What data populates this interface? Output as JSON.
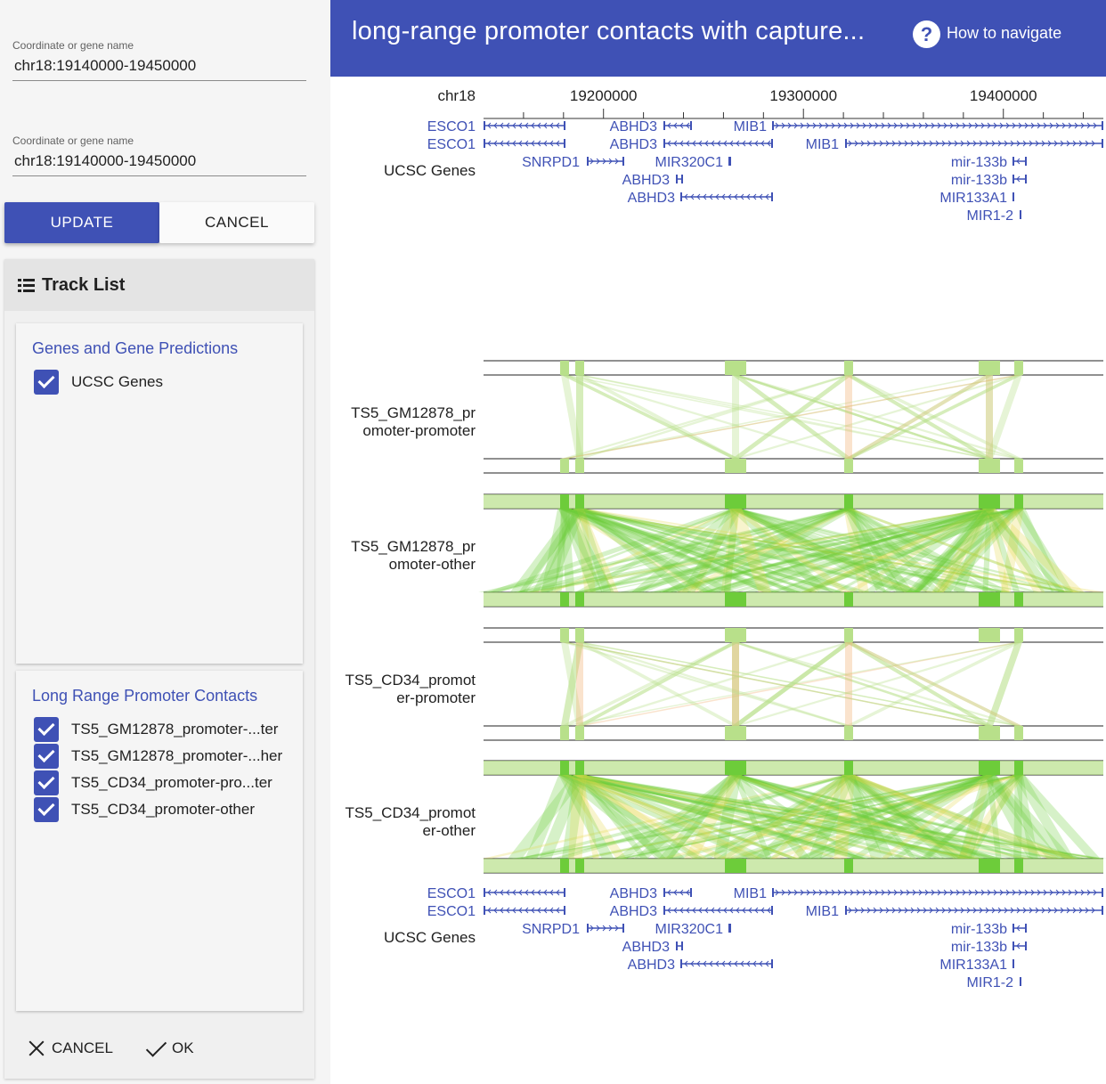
{
  "search": {
    "field1": {
      "label": "Coordinate or gene name",
      "value": "chr18:19140000-19450000"
    },
    "field2": {
      "label": "Coordinate or gene name",
      "value": "chr18:19140000-19450000"
    },
    "update_label": "UPDATE",
    "cancel_label": "CANCEL"
  },
  "tracklist": {
    "title": "Track List",
    "groups": [
      {
        "title": "Genes and Gene Predictions",
        "items": [
          "UCSC Genes"
        ]
      },
      {
        "title": "Long Range Promoter Contacts",
        "items": [
          "TS5_GM12878_promoter-...ter",
          "TS5_GM12878_promoter-...her",
          "TS5_CD34_promoter-pro...ter",
          "TS5_CD34_promoter-other"
        ]
      }
    ],
    "footer": {
      "cancel_label": "CANCEL",
      "ok_label": "OK"
    }
  },
  "header": {
    "title": "long-range promoter contacts with capture...",
    "help_label": "How to navigate",
    "help_icon": "help-circle-icon"
  },
  "browser": {
    "chromosome": "chr18",
    "ticks": [
      {
        "pos": 19200000,
        "label": "19200000"
      },
      {
        "pos": 19300000,
        "label": "19300000"
      },
      {
        "pos": 19400000,
        "label": "19400000"
      }
    ],
    "gene_track_label": "UCSC Genes",
    "interaction_tracks": [
      {
        "label_lines": [
          "TS5_GM12878_pr",
          "omoter-promoter"
        ],
        "type": "promoter-promoter"
      },
      {
        "label_lines": [
          "TS5_GM12878_pr",
          "omoter-other"
        ],
        "type": "promoter-other"
      },
      {
        "label_lines": [
          "TS5_CD34_promot",
          "er-promoter"
        ],
        "type": "promoter-promoter"
      },
      {
        "label_lines": [
          "TS5_CD34_promot",
          "er-other"
        ],
        "type": "promoter-other"
      }
    ],
    "genes": [
      {
        "name": "ESCO1",
        "row": 0,
        "dir": "-"
      },
      {
        "name": "ABHD3",
        "row": 0,
        "dir": "-"
      },
      {
        "name": "MIB1",
        "row": 0,
        "dir": "+"
      },
      {
        "name": "ESCO1",
        "row": 1,
        "dir": "-"
      },
      {
        "name": "ABHD3",
        "row": 1,
        "dir": "-"
      },
      {
        "name": "MIB1",
        "row": 1,
        "dir": "+"
      },
      {
        "name": "SNRPD1",
        "row": 2,
        "dir": "+"
      },
      {
        "name": "MIR320C1",
        "row": 2,
        "dir": "+"
      },
      {
        "name": "mir-133b",
        "row": 2,
        "dir": "-"
      },
      {
        "name": "ABHD3",
        "row": 3,
        "dir": "-"
      },
      {
        "name": "mir-133b",
        "row": 3,
        "dir": "-"
      },
      {
        "name": "ABHD3",
        "row": 4,
        "dir": "-"
      },
      {
        "name": "MIR133A1",
        "row": 4,
        "dir": "+"
      },
      {
        "name": "MIR1-2",
        "row": 5,
        "dir": "+"
      }
    ],
    "colors": {
      "gene": "#3f51b5",
      "contact_strong": "#6dcc3a",
      "contact_weak": "#b8e08a",
      "contact_orange": "#f0b070",
      "contact_yellow": "#e6d84a"
    }
  }
}
